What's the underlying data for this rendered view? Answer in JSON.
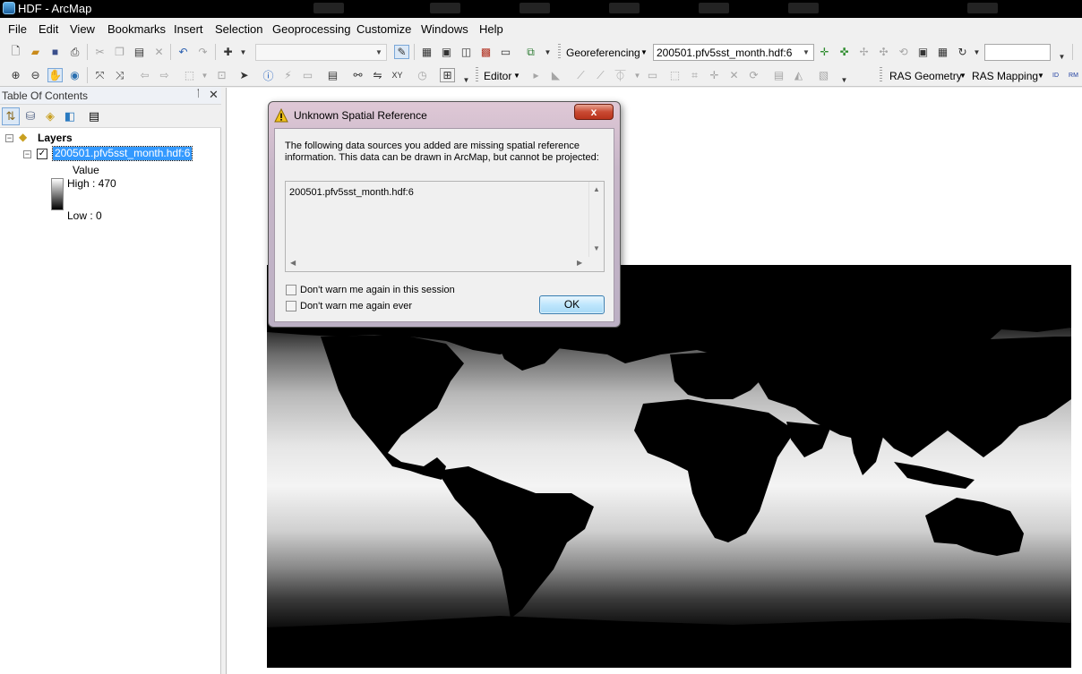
{
  "window": {
    "title": "HDF - ArcMap"
  },
  "menu": [
    "File",
    "Edit",
    "View",
    "Bookmarks",
    "Insert",
    "Selection",
    "Geoprocessing",
    "Customize",
    "Windows",
    "Help"
  ],
  "toolbar1": {
    "georeferencing_label": "Georeferencing",
    "georef_layer_value": "200501.pfv5sst_month.hdf:6",
    "scale_value": "",
    "extra_value": ""
  },
  "toolbar2": {
    "editor_label": "Editor",
    "ras_geometry_label": "RAS Geometry",
    "ras_mapping_label": "RAS Mapping",
    "ras_icon_a": "ID",
    "ras_icon_b": "RM"
  },
  "toc": {
    "title": "Table Of Contents",
    "pin": "ᛙ",
    "close": "✕",
    "root_label": "Layers",
    "layer": {
      "name": "200501.pfv5sst_month.hdf:6",
      "checked": true,
      "legend_field": "Value",
      "high_label": "High : 470",
      "low_label": "Low : 0"
    }
  },
  "dialog": {
    "title": "Unknown Spatial Reference",
    "close_symbol": "x",
    "message": "The following data sources you added are missing spatial reference information. This data can be drawn in ArcMap, but cannot be projected:",
    "items": [
      "200501.pfv5sst_month.hdf:6"
    ],
    "checkbox_session": "Don't warn me again in this session",
    "checkbox_ever": "Don't warn me again ever",
    "ok_label": "OK"
  },
  "icons": {
    "app": "arcmap-icon",
    "warning": "warning-icon"
  },
  "colors": {
    "selection": "#3399ff",
    "dialog_close": "#c94a33",
    "ok_button": "#bee6fd"
  }
}
